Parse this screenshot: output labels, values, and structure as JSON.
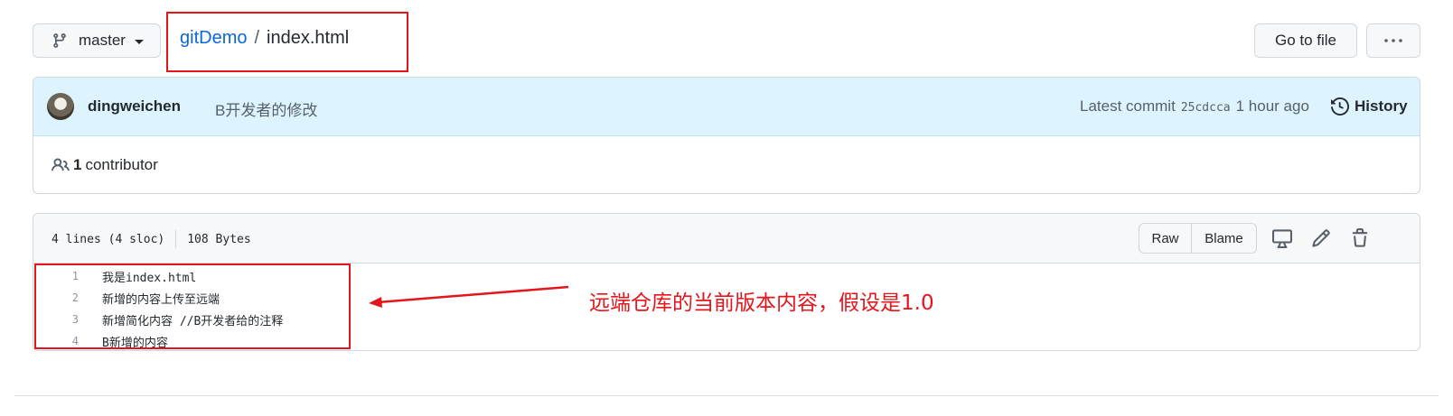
{
  "header": {
    "branch": "master",
    "repo": "gitDemo",
    "separator": "/",
    "file": "index.html",
    "goto_file": "Go to file",
    "more": "···"
  },
  "commit": {
    "author": "dingweichen",
    "message": "B开发者的修改",
    "latest_label": "Latest commit",
    "sha": "25cdcca",
    "time": "1 hour ago",
    "history": "History"
  },
  "contributors": {
    "count": "1",
    "label": "contributor"
  },
  "file": {
    "lines_info": "4 lines (4 sloc)",
    "size": "108 Bytes",
    "raw": "Raw",
    "blame": "Blame",
    "code": [
      {
        "num": "1",
        "text": "我是index.html"
      },
      {
        "num": "2",
        "text": "新增的内容上传至远端"
      },
      {
        "num": "3",
        "text": "新增简化内容 //B开发者给的注释"
      },
      {
        "num": "4",
        "text": "B新增的内容"
      }
    ]
  },
  "annotation": {
    "text": "远端仓库的当前版本内容，假设是1.0",
    "color": "#e5151c"
  },
  "icons": [
    "branch-icon",
    "chevron-down-icon",
    "kebab-horizontal-icon",
    "avatar",
    "history-icon",
    "people-icon",
    "desktop-icon",
    "pencil-icon",
    "trash-icon"
  ],
  "colors": {
    "link": "#0969da",
    "commit_bg": "#ddf4ff",
    "highlight_red": "#e5151c"
  }
}
